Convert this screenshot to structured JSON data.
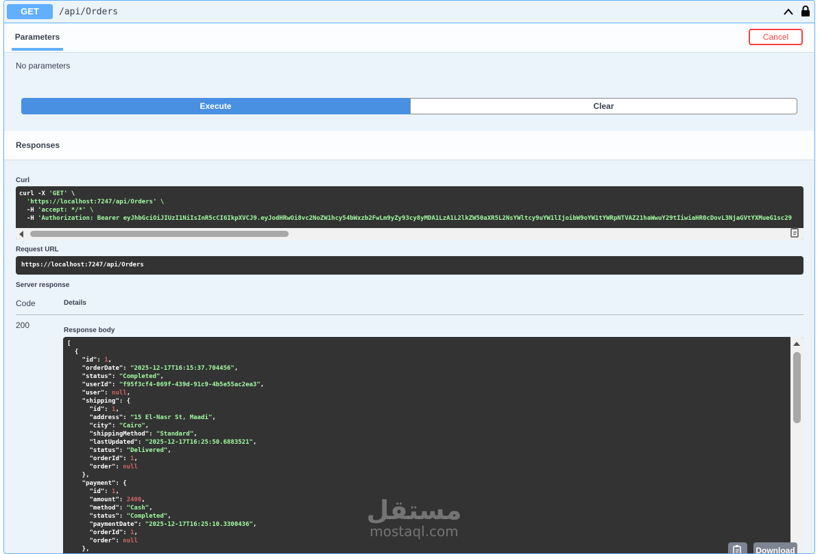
{
  "operation": {
    "method": "GET",
    "path": "/api/Orders"
  },
  "parameters": {
    "tab_label": "Parameters",
    "cancel_label": "Cancel",
    "empty_text": "No parameters"
  },
  "actions": {
    "execute_label": "Execute",
    "clear_label": "Clear"
  },
  "responses": {
    "heading": "Responses",
    "curl_label": "Curl",
    "curl_lines": [
      "curl -X 'GET' \\",
      "  'https://localhost:7247/api/Orders' \\",
      "  -H 'accept: */*' \\",
      "  -H 'Authorization: Bearer eyJhbGciOiJIUzI1NiIsInR5cCI6IkpXVCJ9.eyJodHRwOi8vc2NoZW1hcy54bWxzb2FwLm9yZy93cy8yMDA1LzA1L2lkZW50aXR5L2NsYWltcy9uYW1lIjoibW9oYW1tYWRpNTVAZ21haWwuY29tIiwiaHR0cDovL3NjaGVtYXMueG1sc29"
    ],
    "request_url_label": "Request URL",
    "request_url": "https://localhost:7247/api/Orders",
    "server_response_label": "Server response",
    "col_code": "Code",
    "col_details": "Details",
    "status_code": "200",
    "response_body_label": "Response body",
    "download_label": "Download"
  },
  "response_body_lines": [
    [
      {
        "t": "k",
        "v": "["
      }
    ],
    [
      {
        "t": "k",
        "v": "  {"
      }
    ],
    [
      {
        "t": "k",
        "v": "    \"id\": "
      },
      {
        "t": "n",
        "v": "1"
      },
      {
        "t": "k",
        "v": ","
      }
    ],
    [
      {
        "t": "k",
        "v": "    \"orderDate\": "
      },
      {
        "t": "s",
        "v": "\"2025-12-17T16:15:37.704456\""
      },
      {
        "t": "k",
        "v": ","
      }
    ],
    [
      {
        "t": "k",
        "v": "    \"status\": "
      },
      {
        "t": "s",
        "v": "\"Completed\""
      },
      {
        "t": "k",
        "v": ","
      }
    ],
    [
      {
        "t": "k",
        "v": "    \"userId\": "
      },
      {
        "t": "s",
        "v": "\"f95f3cf4-069f-439d-91c9-4b5e55ac2ea3\""
      },
      {
        "t": "k",
        "v": ","
      }
    ],
    [
      {
        "t": "k",
        "v": "    \"user\": "
      },
      {
        "t": "n",
        "v": "null"
      },
      {
        "t": "k",
        "v": ","
      }
    ],
    [
      {
        "t": "k",
        "v": "    \"shipping\": {"
      }
    ],
    [
      {
        "t": "k",
        "v": "      \"id\": "
      },
      {
        "t": "n",
        "v": "1"
      },
      {
        "t": "k",
        "v": ","
      }
    ],
    [
      {
        "t": "k",
        "v": "      \"address\": "
      },
      {
        "t": "s",
        "v": "\"15 El-Nasr St, Maadi\""
      },
      {
        "t": "k",
        "v": ","
      }
    ],
    [
      {
        "t": "k",
        "v": "      \"city\": "
      },
      {
        "t": "s",
        "v": "\"Cairo\""
      },
      {
        "t": "k",
        "v": ","
      }
    ],
    [
      {
        "t": "k",
        "v": "      \"shippingMethod\": "
      },
      {
        "t": "s",
        "v": "\"Standard\""
      },
      {
        "t": "k",
        "v": ","
      }
    ],
    [
      {
        "t": "k",
        "v": "      \"lastUpdated\": "
      },
      {
        "t": "s",
        "v": "\"2025-12-17T16:25:50.6883521\""
      },
      {
        "t": "k",
        "v": ","
      }
    ],
    [
      {
        "t": "k",
        "v": "      \"status\": "
      },
      {
        "t": "s",
        "v": "\"Delivered\""
      },
      {
        "t": "k",
        "v": ","
      }
    ],
    [
      {
        "t": "k",
        "v": "      \"orderId\": "
      },
      {
        "t": "n",
        "v": "1"
      },
      {
        "t": "k",
        "v": ","
      }
    ],
    [
      {
        "t": "k",
        "v": "      \"order\": "
      },
      {
        "t": "n",
        "v": "null"
      }
    ],
    [
      {
        "t": "k",
        "v": "    },"
      }
    ],
    [
      {
        "t": "k",
        "v": "    \"payment\": {"
      }
    ],
    [
      {
        "t": "k",
        "v": "      \"id\": "
      },
      {
        "t": "n",
        "v": "1"
      },
      {
        "t": "k",
        "v": ","
      }
    ],
    [
      {
        "t": "k",
        "v": "      \"amount\": "
      },
      {
        "t": "n",
        "v": "2400"
      },
      {
        "t": "k",
        "v": ","
      }
    ],
    [
      {
        "t": "k",
        "v": "      \"method\": "
      },
      {
        "t": "s",
        "v": "\"Cash\""
      },
      {
        "t": "k",
        "v": ","
      }
    ],
    [
      {
        "t": "k",
        "v": "      \"status\": "
      },
      {
        "t": "s",
        "v": "\"Completed\""
      },
      {
        "t": "k",
        "v": ","
      }
    ],
    [
      {
        "t": "k",
        "v": "      \"paymentDate\": "
      },
      {
        "t": "s",
        "v": "\"2025-12-17T16:25:10.3300436\""
      },
      {
        "t": "k",
        "v": ","
      }
    ],
    [
      {
        "t": "k",
        "v": "      \"orderId\": "
      },
      {
        "t": "n",
        "v": "1"
      },
      {
        "t": "k",
        "v": ","
      }
    ],
    [
      {
        "t": "k",
        "v": "      \"order\": "
      },
      {
        "t": "n",
        "v": "null"
      }
    ],
    [
      {
        "t": "k",
        "v": "    },"
      }
    ]
  ],
  "watermark": {
    "arabic": "مستقل",
    "latin": "mostaql.com"
  },
  "colors": {
    "get_blue": "#61affe",
    "execute_blue": "#4990e2",
    "cancel_red": "#f93e3e",
    "code_bg": "#333333",
    "string_green": "#a2fca2",
    "number_red": "#d36363"
  },
  "icons": [
    "chevron-up-icon",
    "lock-icon",
    "copy-icon",
    "scroll-left-arrow-icon",
    "scroll-up-arrow-icon"
  ]
}
